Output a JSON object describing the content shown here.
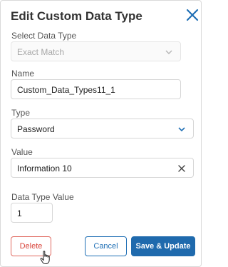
{
  "dialog": {
    "title": "Edit Custom Data Type",
    "close_icon": "close-icon"
  },
  "fields": {
    "select_data_type": {
      "label": "Select Data Type",
      "value": "Exact Match",
      "disabled": true
    },
    "name": {
      "label": "Name",
      "value": "Custom_Data_Types11_1"
    },
    "type": {
      "label": "Type",
      "value": "Password"
    },
    "value": {
      "label": "Value",
      "value": "Information 10"
    },
    "data_type_value": {
      "label": "Data Type Value",
      "value": "1"
    }
  },
  "buttons": {
    "delete": "Delete",
    "cancel": "Cancel",
    "save_update": "Save & Update"
  },
  "colors": {
    "accent": "#1f6aad",
    "danger": "#d9463c",
    "close_icon": "#1f6fb5"
  }
}
